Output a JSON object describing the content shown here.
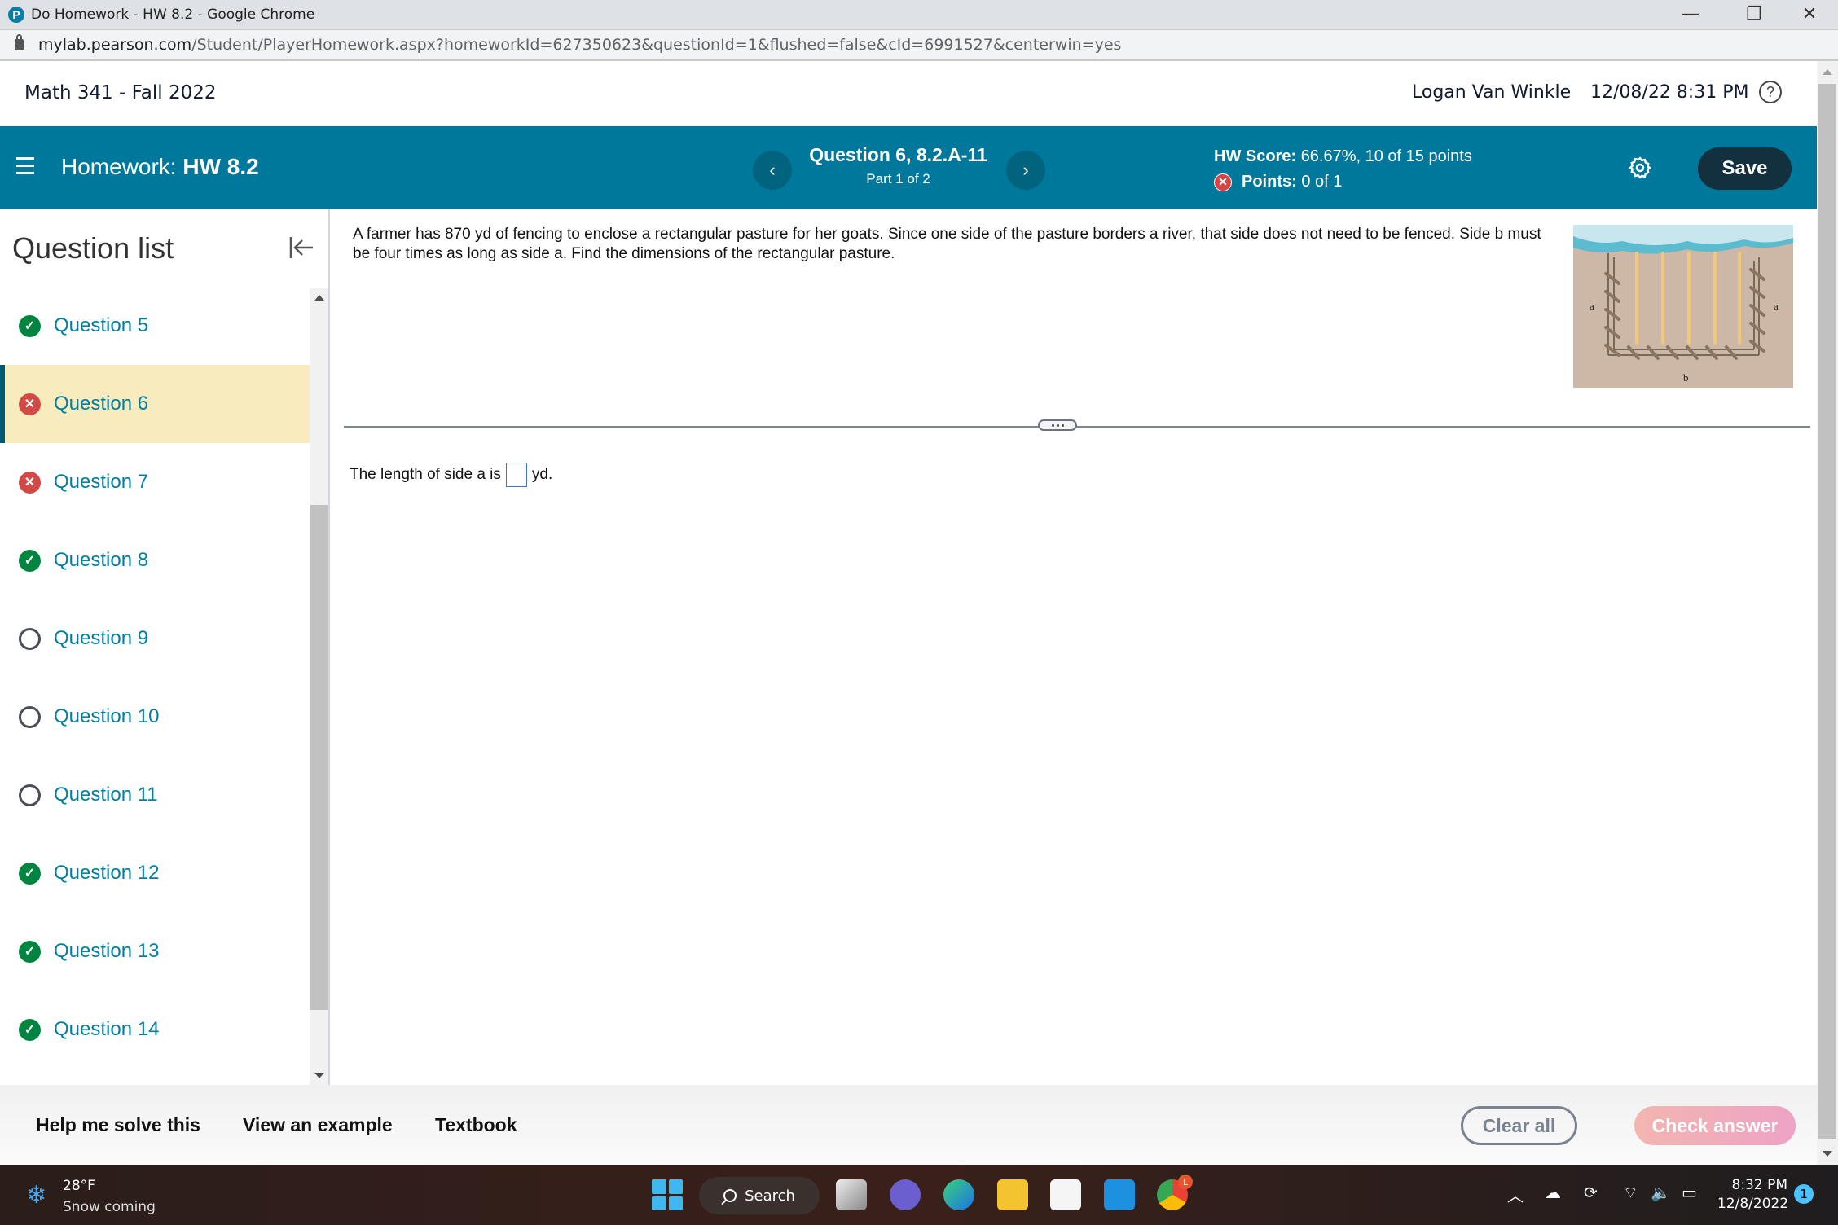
{
  "browser": {
    "window_title": "Do Homework - HW 8.2 - Google Chrome",
    "favicon": "P",
    "url_host": "mylab.pearson.com",
    "url_path": "/Student/PlayerHomework.aspx?homeworkId=627350623&questionId=1&flushed=false&cId=6991527&centerwin=yes",
    "controls": {
      "minimize": "—",
      "restore": "❐",
      "close": "✕"
    }
  },
  "course_header": {
    "course_name": "Math 341 - Fall 2022",
    "user_name": "Logan Van Winkle",
    "datetime": "12/08/22 8:31 PM",
    "help_icon": "?"
  },
  "hw_bar": {
    "homework_label": "Homework:",
    "homework_name": "HW 8.2",
    "prev_label": "‹",
    "next_label": "›",
    "question_title": "Question 6, 8.2.A-11",
    "question_part": "Part 1 of 2",
    "hw_score_label": "HW Score:",
    "hw_score_value": "66.67%, 10 of 15 points",
    "points_label": "Points:",
    "points_value": "0 of 1",
    "points_status_icon": "✕",
    "save_label": "Save",
    "colors": {
      "bar": "#00789b",
      "save": "#13303f"
    }
  },
  "sidebar": {
    "title": "Question list",
    "items": [
      {
        "label": "Question 5",
        "status": "correct",
        "icon": "✓"
      },
      {
        "label": "Question 6",
        "status": "incorrect",
        "icon": "✕",
        "active": true
      },
      {
        "label": "Question 7",
        "status": "incorrect",
        "icon": "✕"
      },
      {
        "label": "Question 8",
        "status": "correct",
        "icon": "✓"
      },
      {
        "label": "Question 9",
        "status": "unanswered",
        "icon": ""
      },
      {
        "label": "Question 10",
        "status": "unanswered",
        "icon": ""
      },
      {
        "label": "Question 11",
        "status": "unanswered",
        "icon": ""
      },
      {
        "label": "Question 12",
        "status": "correct",
        "icon": "✓"
      },
      {
        "label": "Question 13",
        "status": "correct",
        "icon": "✓"
      },
      {
        "label": "Question 14",
        "status": "correct",
        "icon": "✓"
      }
    ],
    "colors": {
      "correct": "#008540",
      "incorrect": "#d14a48",
      "active_bg": "#f8ebbe",
      "link": "#007fa3"
    }
  },
  "question": {
    "text": "A farmer has 870 yd of fencing to enclose a rectangular pasture for her goats. Since one side of the pasture borders a river, that side does not need to be fenced. Side b must be four times as long as side a. Find the dimensions of the rectangular pasture.",
    "figure": {
      "label_left": "a",
      "label_right": "a",
      "label_bottom": "b"
    },
    "answer_prefix": "The length of side a is",
    "answer_value": "",
    "answer_suffix": "yd."
  },
  "bottom_bar": {
    "help_label": "Help me solve this",
    "example_label": "View an example",
    "textbook_label": "Textbook",
    "clear_label": "Clear all",
    "check_label": "Check answer"
  },
  "taskbar": {
    "weather_temp": "28°F",
    "weather_desc": "Snow coming",
    "search_label": "Search",
    "time": "8:32 PM",
    "date": "12/8/2022",
    "notification_count": "1",
    "chrome_badge": "L"
  }
}
